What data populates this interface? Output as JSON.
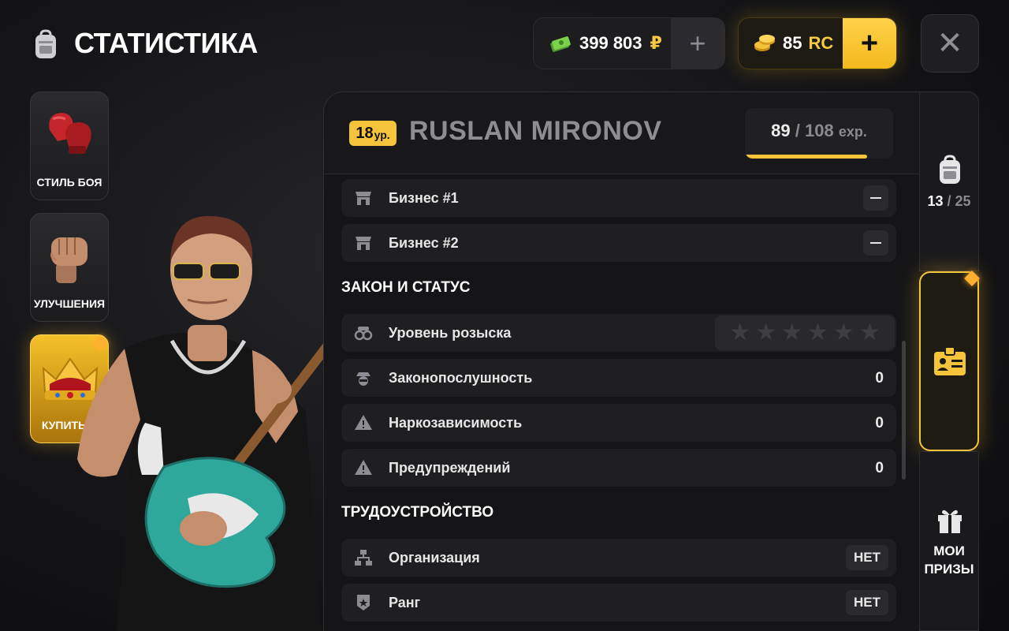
{
  "header": {
    "title": "СТАТИСТИКА",
    "money": {
      "amount": "399 803",
      "currency": "₽"
    },
    "rc": {
      "amount": "85",
      "currency": "RC"
    },
    "add_label": "+",
    "close_label": "✕"
  },
  "left_tabs": [
    {
      "label": "СТИЛЬ БОЯ",
      "icon": "boxing-gloves-icon"
    },
    {
      "label": "УЛУЧШЕНИЯ",
      "icon": "fist-icon"
    },
    {
      "label": "КУПИТЬ В",
      "icon": "crown-icon"
    }
  ],
  "player": {
    "level": "18",
    "level_unit": "ур.",
    "name": "RUSLAN MIRONOV",
    "exp_current": "89",
    "exp_sep": "/",
    "exp_max": "108",
    "exp_unit": "exp.",
    "exp_progress": 0.824
  },
  "rows": {
    "business1": "Бизнес #1",
    "business2": "Бизнес #2",
    "section_law": "ЗАКОН И СТАТУС",
    "wanted": "Уровень розыска",
    "wanted_stars": 0,
    "wanted_star_max": 6,
    "law_abiding": "Законопослушность",
    "law_abiding_value": "0",
    "drug_addiction": "Наркозависимость",
    "drug_addiction_value": "0",
    "warnings": "Предупреждений",
    "warnings_value": "0",
    "section_job": "ТРУДОУСТРОЙСТВО",
    "organization": "Организация",
    "organization_value": "НЕТ",
    "rank": "Ранг",
    "rank_value": "НЕТ"
  },
  "right_tabs": {
    "inventory_count": "13",
    "inventory_sep": "/",
    "inventory_max": "25",
    "prizes_line1": "МОИ",
    "prizes_line2": "ПРИЗЫ"
  },
  "colors": {
    "accent": "#f6c43a",
    "panel": "#151517",
    "row": "#1f1f22"
  }
}
